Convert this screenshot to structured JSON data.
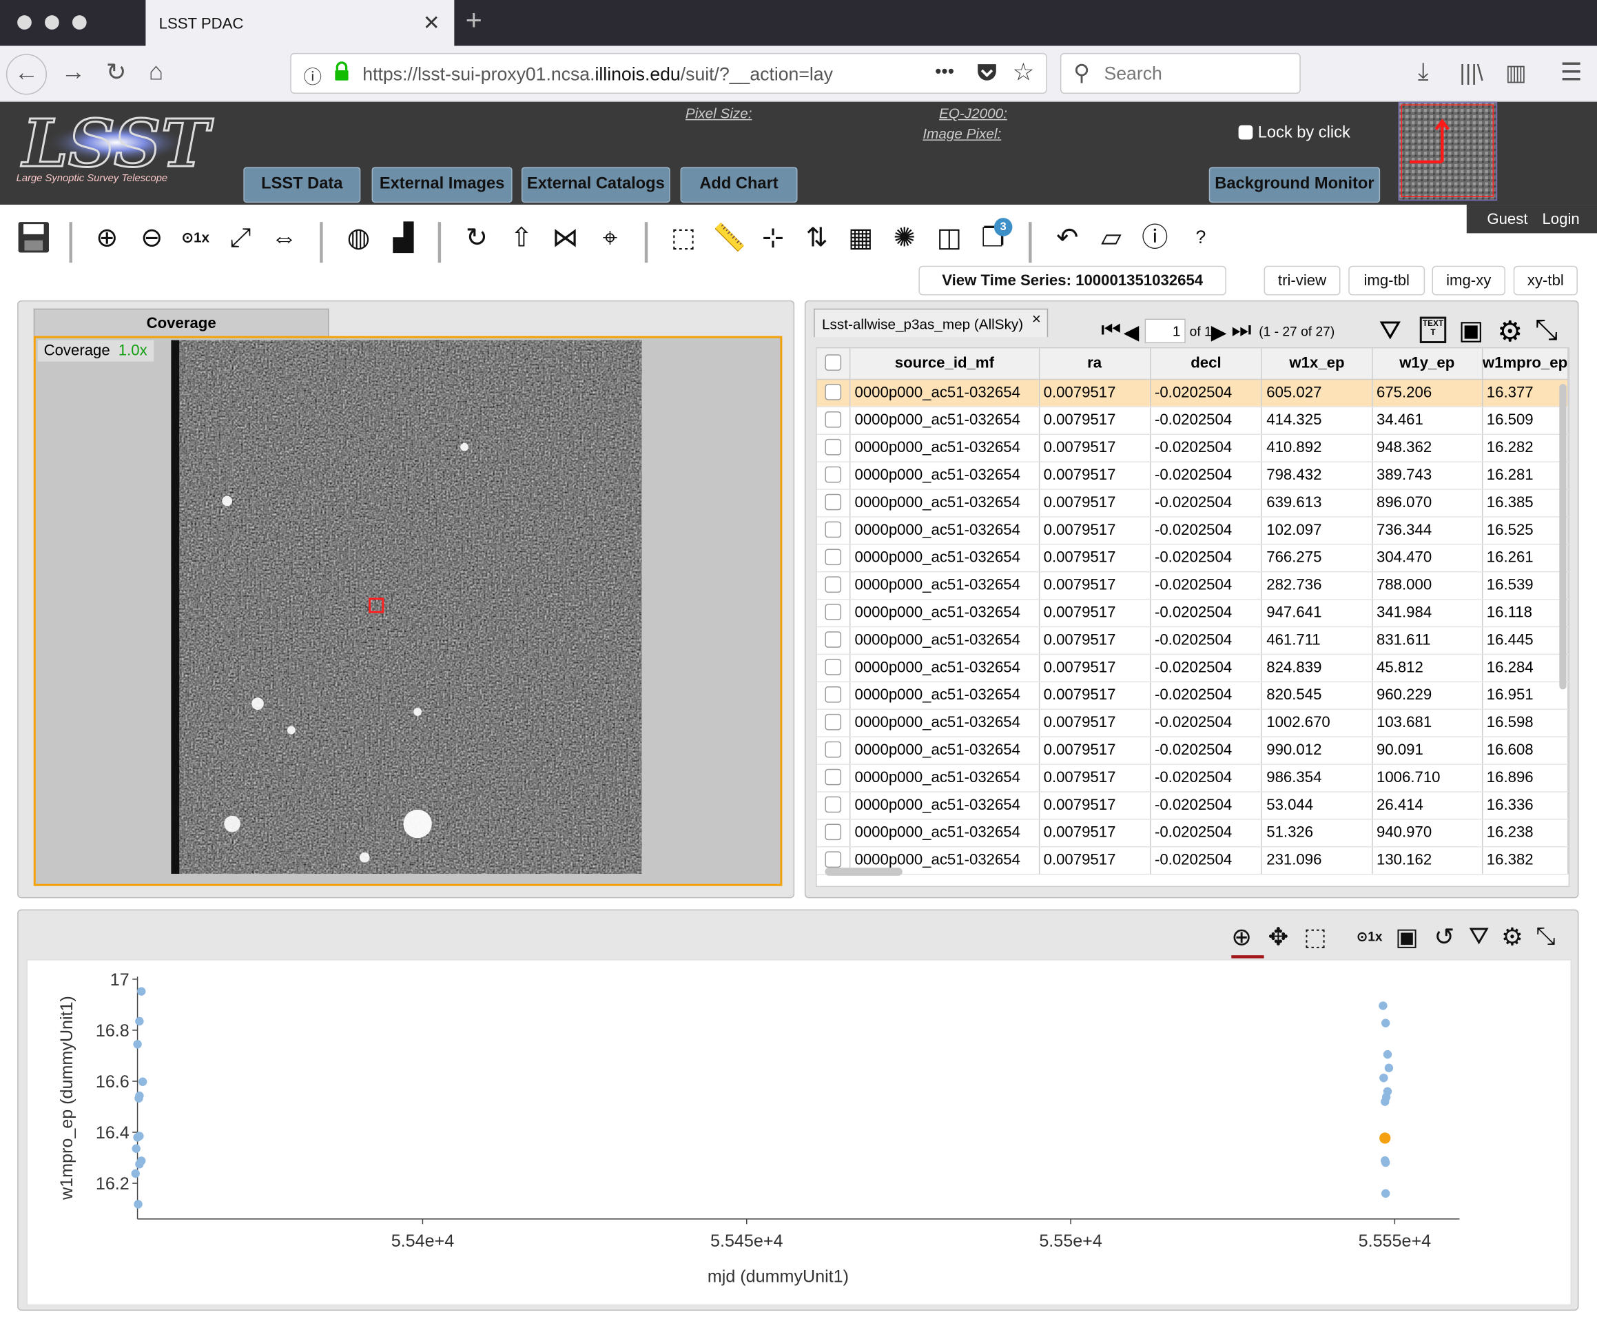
{
  "browser": {
    "tab_title": "LSST PDAC",
    "url_prefix": "https://lsst-sui-proxy01.ncsa.",
    "url_domain": "illinois.edu",
    "url_suffix": "/suit/?__action=lay",
    "search_placeholder": "Search",
    "more": "•••"
  },
  "header": {
    "logo_text": "LSST",
    "logo_subtitle": "Large Synoptic Survey Telescope",
    "pixel_size": "Pixel Size:",
    "eq": "EQ-J2000:",
    "image_pixel": "Image Pixel:",
    "lock_by_click": "Lock by click",
    "buttons": [
      "LSST Data",
      "External Images",
      "External Catalogs",
      "Add Chart"
    ],
    "background_monitor": "Background Monitor",
    "guest": "Guest",
    "login": "Login"
  },
  "toolbar": {
    "badge": "3",
    "help": "?",
    "view_time_series": "View Time Series: 100001351032654",
    "layouts": [
      "tri-view",
      "img-tbl",
      "img-xy",
      "xy-tbl"
    ]
  },
  "coverage": {
    "tab": "Coverage",
    "label": "Coverage",
    "zoom": "1.0x"
  },
  "table": {
    "tab_title": "Lsst-allwise_p3as_mep (AllSky)",
    "close": "×",
    "page": "1",
    "of_pages": "of 1",
    "range": "(1 - 27 of 27)",
    "columns": [
      "source_id_mf",
      "ra",
      "decl",
      "w1x_ep",
      "w1y_ep",
      "w1mpro_ep"
    ],
    "rows": [
      [
        "0000p000_ac51-032654",
        "0.0079517",
        "-0.0202504",
        "605.027",
        "675.206",
        "16.377"
      ],
      [
        "0000p000_ac51-032654",
        "0.0079517",
        "-0.0202504",
        "414.325",
        "34.461",
        "16.509"
      ],
      [
        "0000p000_ac51-032654",
        "0.0079517",
        "-0.0202504",
        "410.892",
        "948.362",
        "16.282"
      ],
      [
        "0000p000_ac51-032654",
        "0.0079517",
        "-0.0202504",
        "798.432",
        "389.743",
        "16.281"
      ],
      [
        "0000p000_ac51-032654",
        "0.0079517",
        "-0.0202504",
        "639.613",
        "896.070",
        "16.385"
      ],
      [
        "0000p000_ac51-032654",
        "0.0079517",
        "-0.0202504",
        "102.097",
        "736.344",
        "16.525"
      ],
      [
        "0000p000_ac51-032654",
        "0.0079517",
        "-0.0202504",
        "766.275",
        "304.470",
        "16.261"
      ],
      [
        "0000p000_ac51-032654",
        "0.0079517",
        "-0.0202504",
        "282.736",
        "788.000",
        "16.539"
      ],
      [
        "0000p000_ac51-032654",
        "0.0079517",
        "-0.0202504",
        "947.641",
        "341.984",
        "16.118"
      ],
      [
        "0000p000_ac51-032654",
        "0.0079517",
        "-0.0202504",
        "461.711",
        "831.611",
        "16.445"
      ],
      [
        "0000p000_ac51-032654",
        "0.0079517",
        "-0.0202504",
        "824.839",
        "45.812",
        "16.284"
      ],
      [
        "0000p000_ac51-032654",
        "0.0079517",
        "-0.0202504",
        "820.545",
        "960.229",
        "16.951"
      ],
      [
        "0000p000_ac51-032654",
        "0.0079517",
        "-0.0202504",
        "1002.670",
        "103.681",
        "16.598"
      ],
      [
        "0000p000_ac51-032654",
        "0.0079517",
        "-0.0202504",
        "990.012",
        "90.091",
        "16.608"
      ],
      [
        "0000p000_ac51-032654",
        "0.0079517",
        "-0.0202504",
        "986.354",
        "1006.710",
        "16.896"
      ],
      [
        "0000p000_ac51-032654",
        "0.0079517",
        "-0.0202504",
        "53.044",
        "26.414",
        "16.336"
      ],
      [
        "0000p000_ac51-032654",
        "0.0079517",
        "-0.0202504",
        "51.326",
        "940.970",
        "16.238"
      ],
      [
        "0000p000_ac51-032654",
        "0.0079517",
        "-0.0202504",
        "231.096",
        "130.162",
        "16.382"
      ]
    ]
  },
  "chart_data": {
    "type": "scatter",
    "xlabel": "mjd (dummyUnit1)",
    "ylabel": "w1mpro_ep (dummyUnit1)",
    "xlim": [
      55356,
      55560
    ],
    "ylim": [
      16.06,
      17.01
    ],
    "xticks": [
      55400,
      55450,
      55500,
      55550
    ],
    "xtick_labels": [
      "5.54e+4",
      "5.545e+4",
      "5.55e+4",
      "5.555e+4"
    ],
    "yticks": [
      16.2,
      16.4,
      16.6,
      16.8,
      17
    ],
    "ytick_labels": [
      "16.2",
      "16.4",
      "16.6",
      "16.8",
      "17"
    ],
    "colors": {
      "points": "#8fb8e0",
      "highlight": "#f5a00f"
    },
    "points": [
      {
        "x": 55356.6,
        "y": 16.952
      },
      {
        "x": 55356.3,
        "y": 16.835
      },
      {
        "x": 55356.0,
        "y": 16.745
      },
      {
        "x": 55356.8,
        "y": 16.598
      },
      {
        "x": 55356.3,
        "y": 16.543
      },
      {
        "x": 55356.2,
        "y": 16.533
      },
      {
        "x": 55356.3,
        "y": 16.385
      },
      {
        "x": 55356.0,
        "y": 16.38
      },
      {
        "x": 55355.8,
        "y": 16.336
      },
      {
        "x": 55356.6,
        "y": 16.288
      },
      {
        "x": 55356.3,
        "y": 16.275
      },
      {
        "x": 55355.7,
        "y": 16.238
      },
      {
        "x": 55356.1,
        "y": 16.118
      },
      {
        "x": 55548.2,
        "y": 16.896
      },
      {
        "x": 55548.6,
        "y": 16.828
      },
      {
        "x": 55548.9,
        "y": 16.705
      },
      {
        "x": 55549.1,
        "y": 16.652
      },
      {
        "x": 55548.3,
        "y": 16.613
      },
      {
        "x": 55548.9,
        "y": 16.56
      },
      {
        "x": 55548.7,
        "y": 16.538
      },
      {
        "x": 55548.5,
        "y": 16.52
      },
      {
        "x": 55548.5,
        "y": 16.289
      },
      {
        "x": 55548.6,
        "y": 16.281
      },
      {
        "x": 55548.6,
        "y": 16.16
      },
      {
        "x": 55548.5,
        "y": 16.377,
        "highlight": true
      }
    ]
  }
}
